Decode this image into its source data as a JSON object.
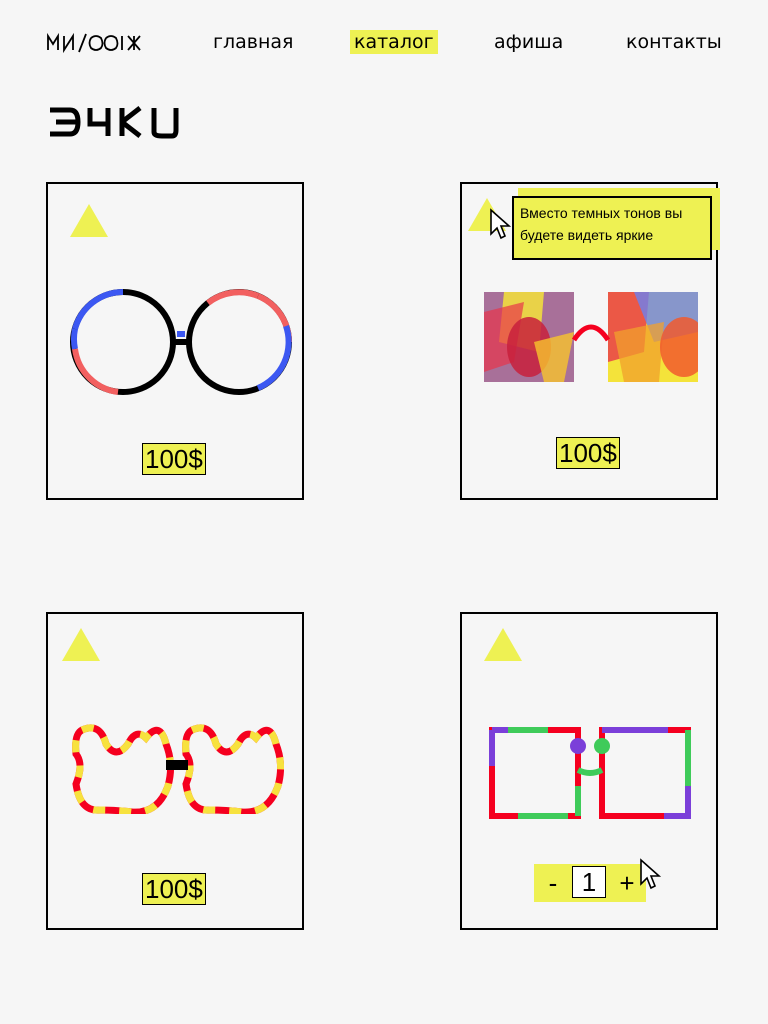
{
  "header": {
    "logo_text": "МИ/ООІЖ",
    "nav": [
      {
        "label": "главная",
        "active": false
      },
      {
        "label": "каталог",
        "active": true
      },
      {
        "label": "афиша",
        "active": false
      },
      {
        "label": "контакты",
        "active": false
      }
    ]
  },
  "page": {
    "title": "Очки"
  },
  "products": [
    {
      "price": "100$",
      "icon": "round-glasses"
    },
    {
      "price": "100$",
      "icon": "square-colorful-glasses",
      "tooltip": "Вместо  темных тонов вы будете видеть яркие"
    },
    {
      "price": "100$",
      "icon": "wavy-glasses"
    },
    {
      "icon": "square-frame-glasses",
      "quantity": {
        "minus": "-",
        "value": "1",
        "plus": "+"
      }
    }
  ],
  "colors": {
    "accent": "#eef153",
    "background": "#f6f6f6"
  }
}
